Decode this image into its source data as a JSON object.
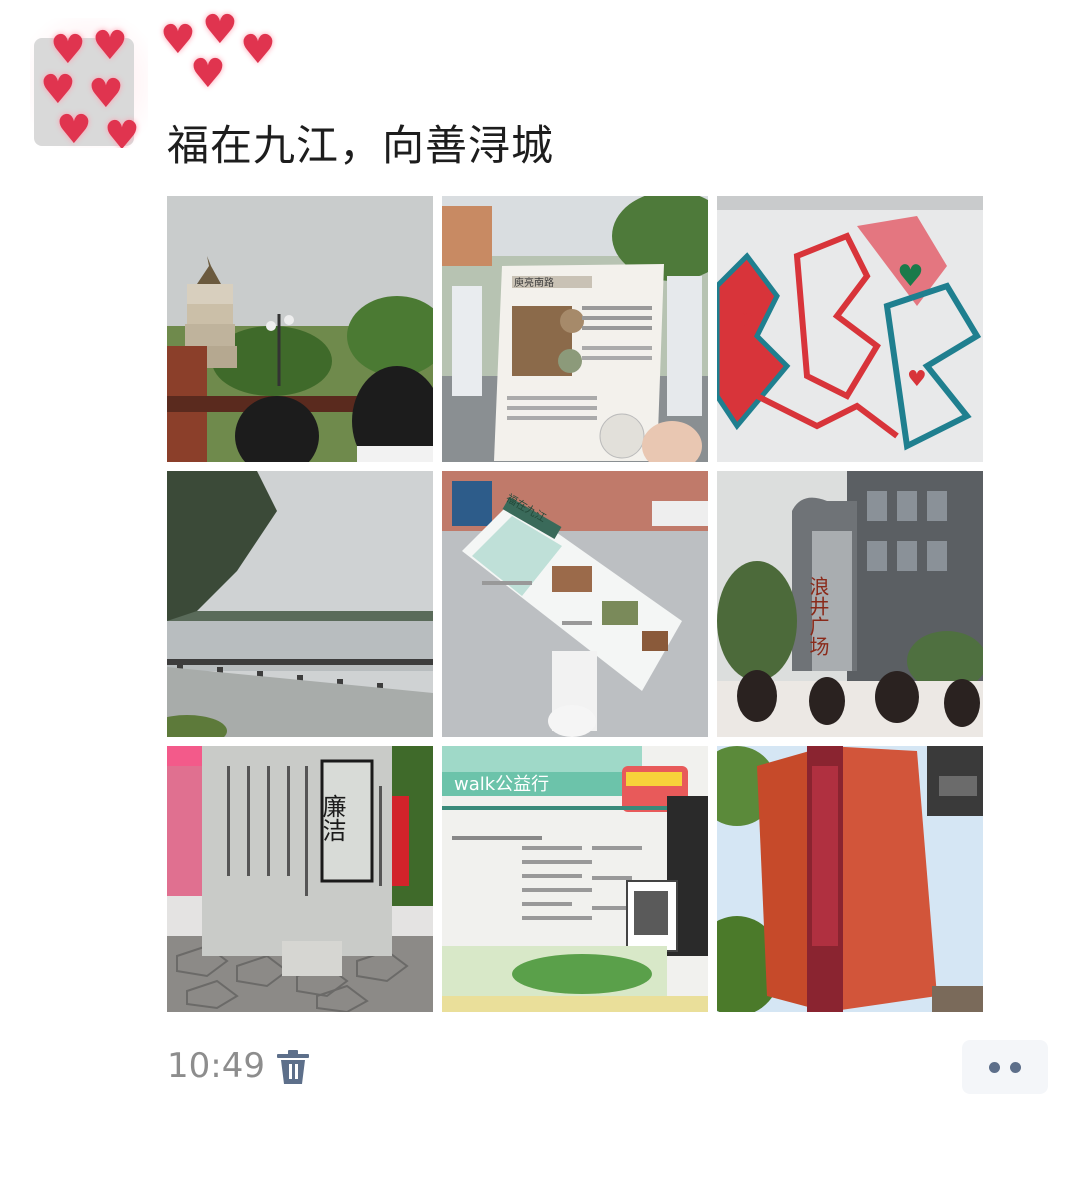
{
  "post": {
    "title": "福在九江，向善浔城",
    "time": "10:49"
  },
  "photos": [
    {
      "name": "pagoda-photo",
      "sign": ""
    },
    {
      "name": "leaflet-photo",
      "sign": "庾亮南路"
    },
    {
      "name": "graffiti-photo",
      "sign": ""
    },
    {
      "name": "lake-photo",
      "sign": ""
    },
    {
      "name": "map-photo",
      "sign": "福在九江"
    },
    {
      "name": "plaza-photo",
      "sign": "浪井广场"
    },
    {
      "name": "stele-photo",
      "sign": "廉洁"
    },
    {
      "name": "board-photo",
      "sign": "walk公益行"
    },
    {
      "name": "tower-photo",
      "sign": ""
    }
  ],
  "colors": {
    "title": "#1d1d1d",
    "time": "#8d8d8d",
    "trash": "#5d6f8a",
    "more_dots": "#5d6f8a",
    "heart": "#e0344f"
  },
  "icons": {
    "trash": "trash-icon",
    "more": "more-dots-icon",
    "heart": "heart-icon"
  }
}
